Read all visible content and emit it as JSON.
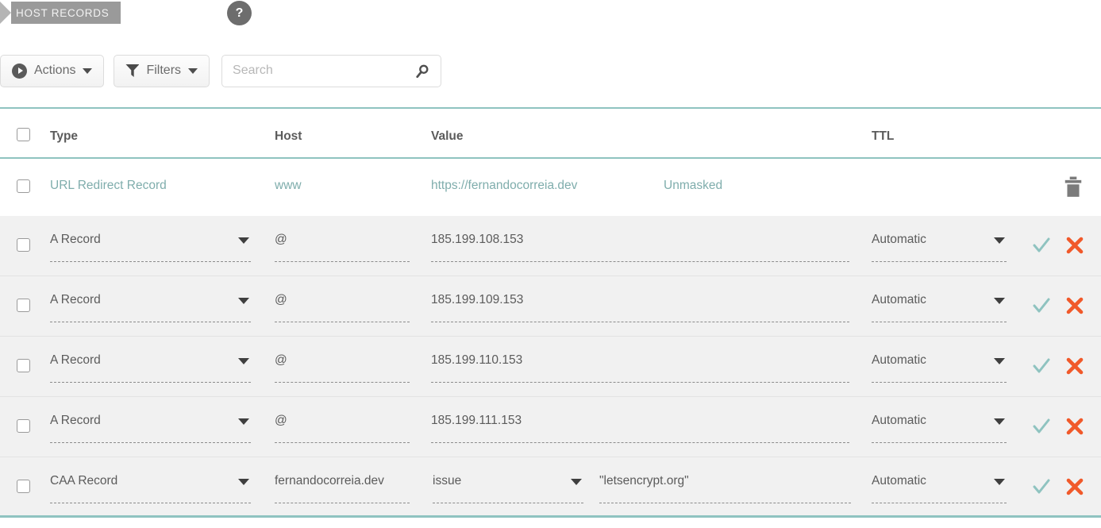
{
  "breadcrumb": {
    "label": "HOST RECORDS",
    "help": "?"
  },
  "toolbar": {
    "actions_label": "Actions",
    "filters_label": "Filters",
    "search_value": "",
    "search_placeholder": "Search"
  },
  "colors": {
    "accent_teal": "#8fc3c0",
    "link_teal": "#7fadac",
    "danger_orange": "#f1592a",
    "tab_gray": "#9a9a9a",
    "row_shade": "#f1f1f1"
  },
  "table": {
    "columns": [
      "Type",
      "Host",
      "Value",
      "TTL"
    ],
    "rows": [
      {
        "kind": "readonly",
        "type": "URL Redirect Record",
        "host": "www",
        "value": "https://fernandocorreia.dev",
        "extra": "Unmasked",
        "ttl": "",
        "actions": [
          "trash-icon"
        ]
      },
      {
        "kind": "editable",
        "type": "A Record",
        "host": "@",
        "value": "185.199.108.153",
        "ttl": "Automatic",
        "actions": [
          "check-icon",
          "close-icon"
        ]
      },
      {
        "kind": "editable",
        "type": "A Record",
        "host": "@",
        "value": "185.199.109.153",
        "ttl": "Automatic",
        "actions": [
          "check-icon",
          "close-icon"
        ]
      },
      {
        "kind": "editable",
        "type": "A Record",
        "host": "@",
        "value": "185.199.110.153",
        "ttl": "Automatic",
        "actions": [
          "check-icon",
          "close-icon"
        ]
      },
      {
        "kind": "editable",
        "type": "A Record",
        "host": "@",
        "value": "185.199.111.153",
        "ttl": "Automatic",
        "actions": [
          "check-icon",
          "close-icon"
        ]
      },
      {
        "kind": "editable-caa",
        "type": "CAA Record",
        "host": "fernandocorreia.dev",
        "tag": "issue",
        "value": "\"letsencrypt.org\"",
        "ttl": "Automatic",
        "actions": [
          "check-icon",
          "close-icon"
        ]
      }
    ]
  }
}
